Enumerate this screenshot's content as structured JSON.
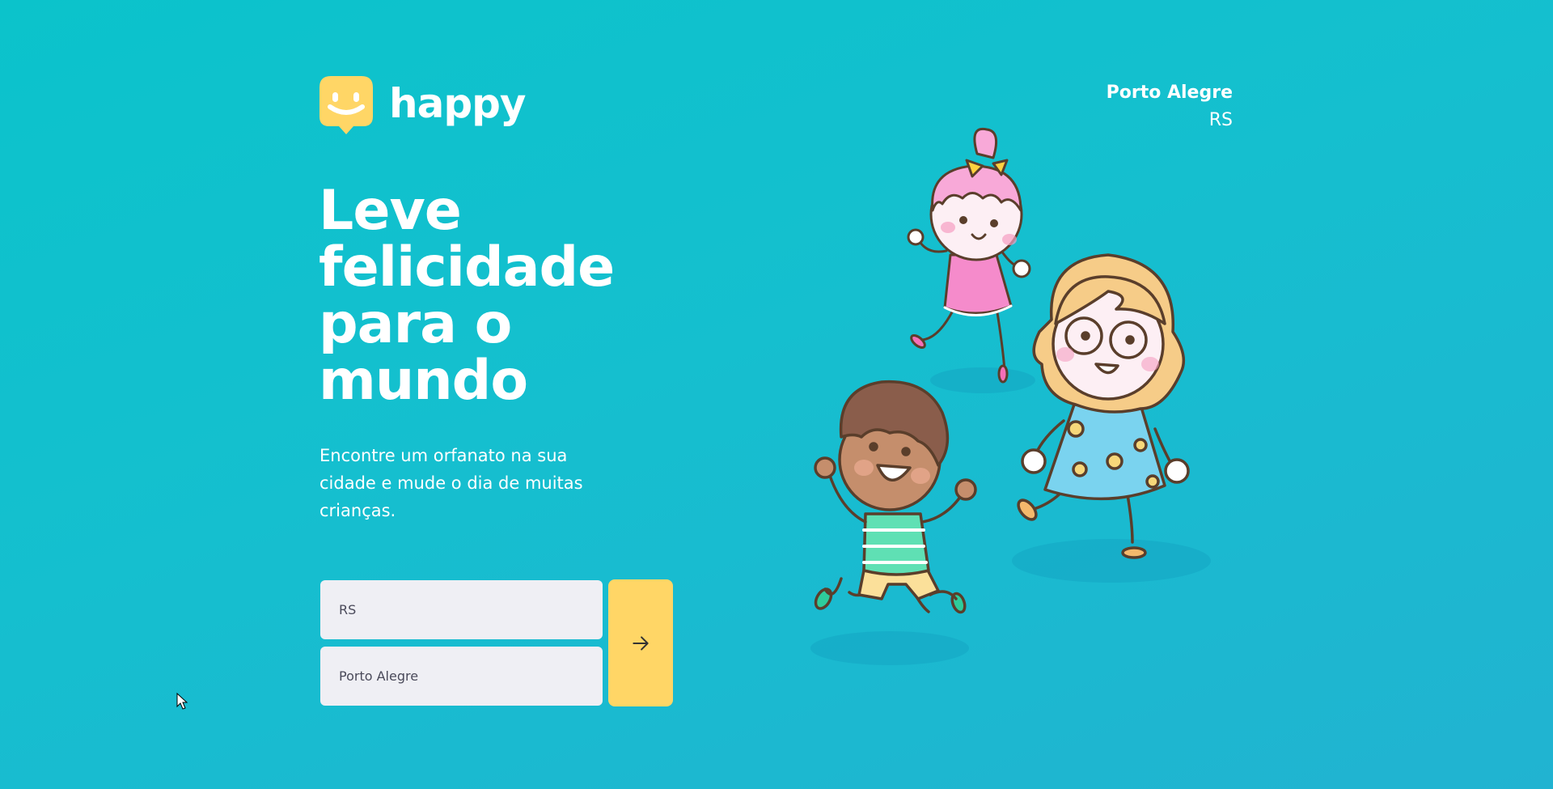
{
  "brand": {
    "name": "happy",
    "logo_icon": "happy-face-icon",
    "accent_color": "#ffd666"
  },
  "location": {
    "city": "Porto Alegre",
    "state": "RS"
  },
  "hero": {
    "title_lines": [
      "Leve",
      "felicidade",
      "para o",
      "mundo"
    ],
    "subtitle": "Encontre um orfanato na sua cidade e mude o dia de muitas crianças."
  },
  "form": {
    "state_value": "RS",
    "city_value": "Porto Alegre",
    "submit_icon": "arrow-right-icon"
  },
  "illustration": {
    "icon": "children-playing-illustration"
  },
  "colors": {
    "background_start": "#0bc3cb",
    "background_end": "#21b3d1",
    "field_background": "#efeff4",
    "button_background": "#ffd666"
  }
}
